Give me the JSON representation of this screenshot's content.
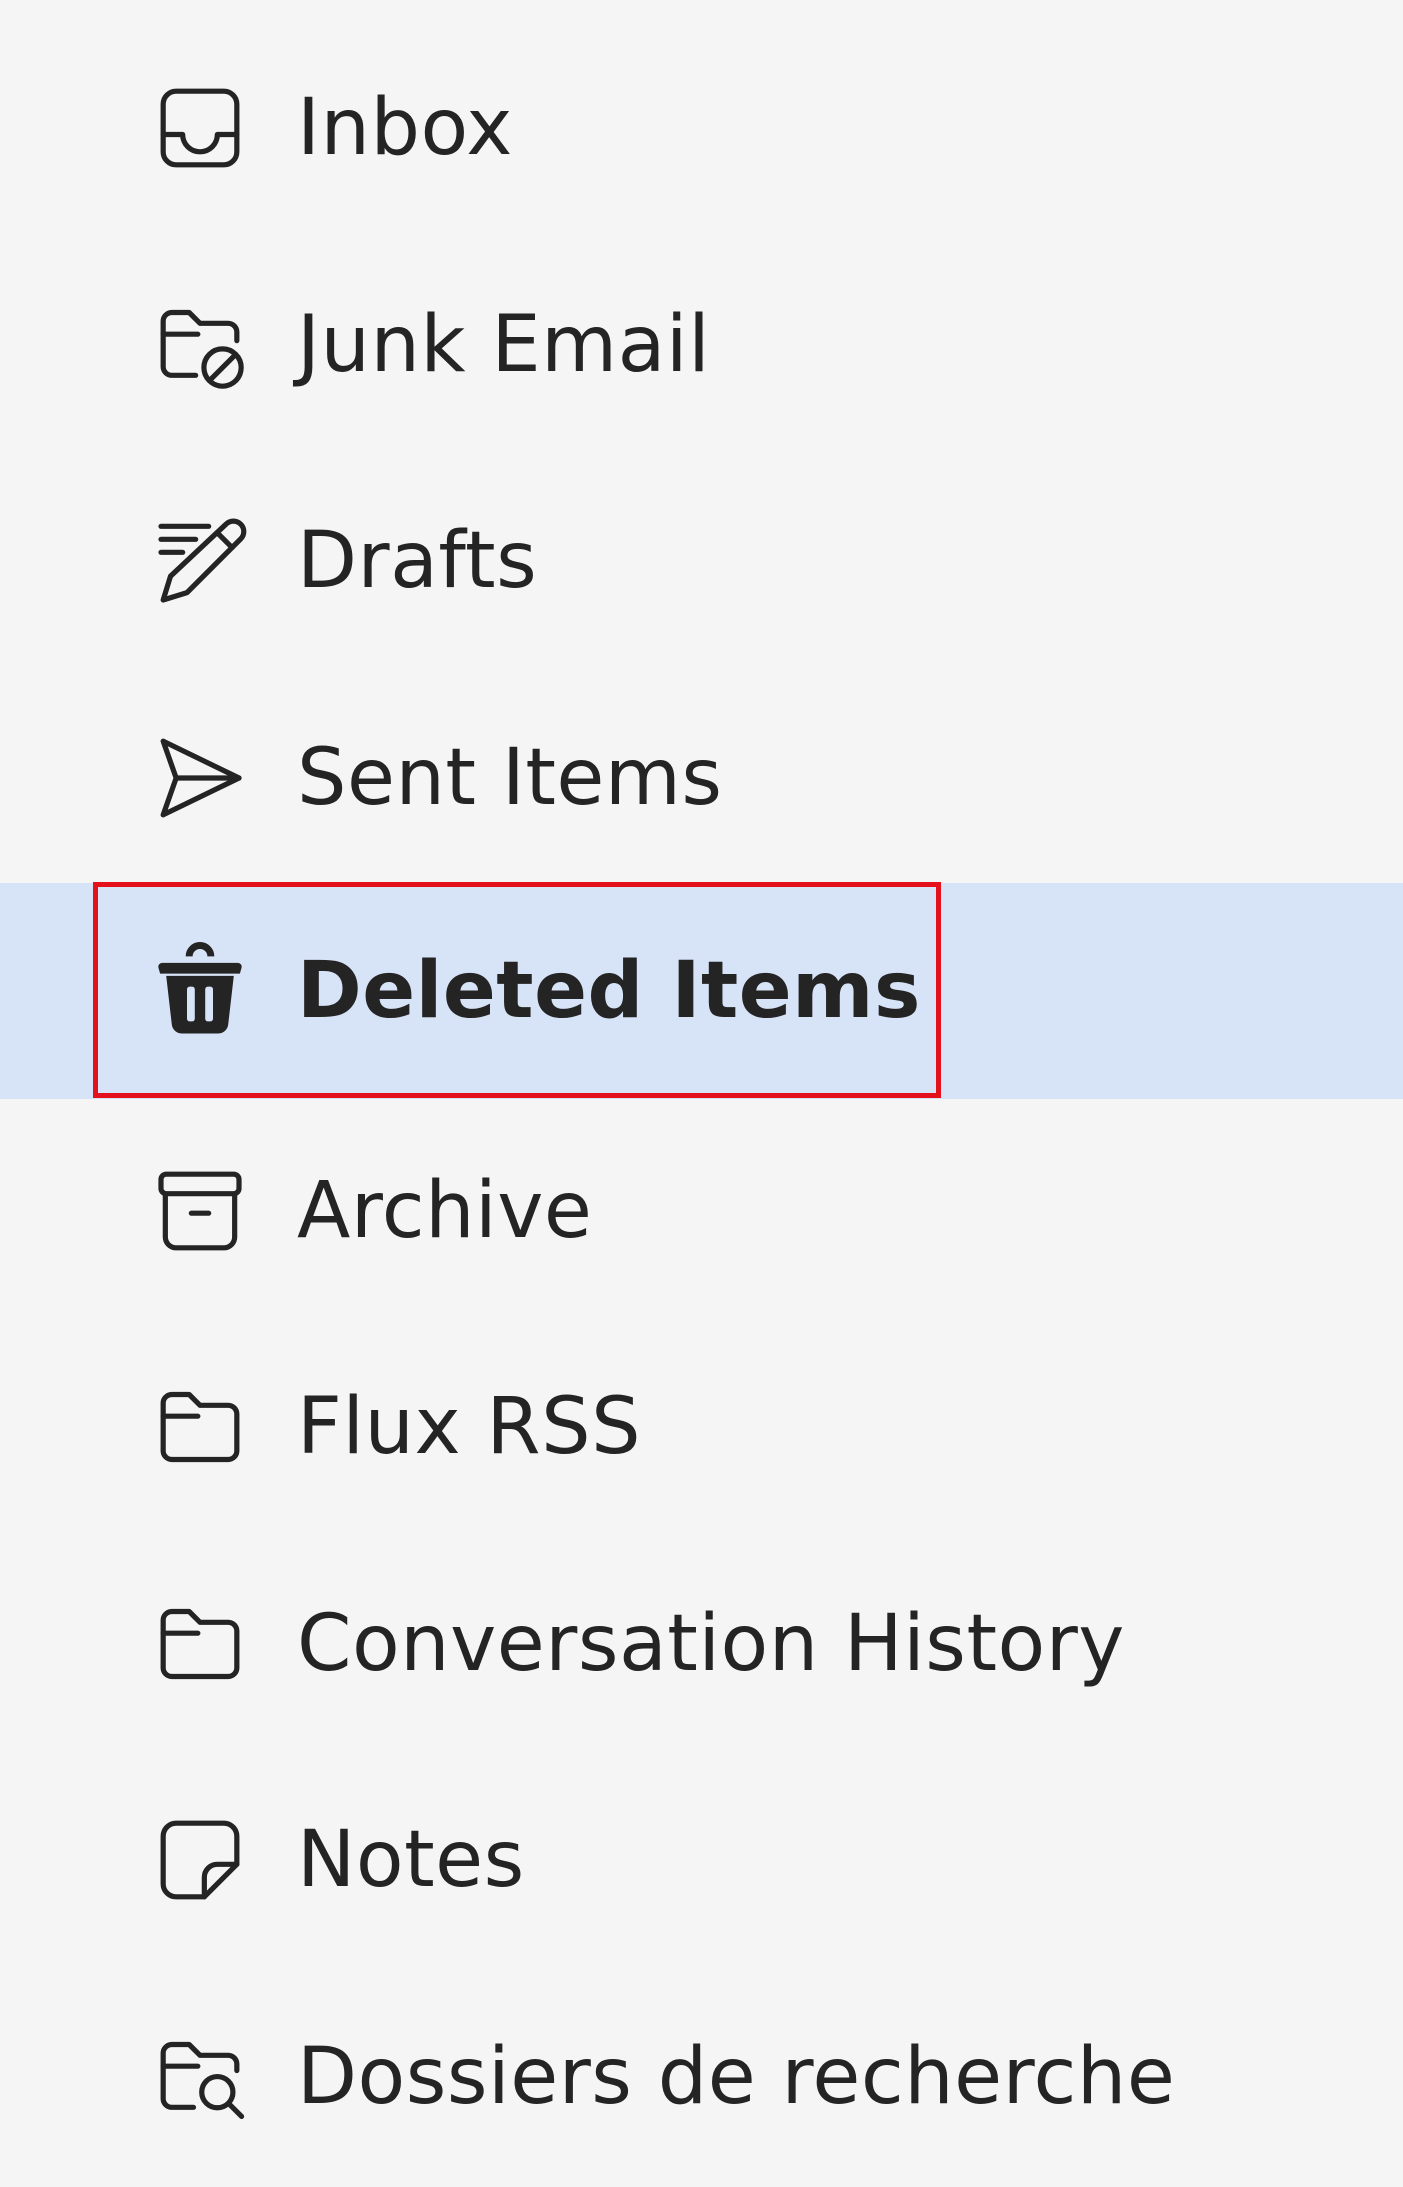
{
  "folder_pane": {
    "items": [
      {
        "label": "Inbox",
        "icon": "inbox-icon",
        "selected": false
      },
      {
        "label": "Junk Email",
        "icon": "junk-folder-icon",
        "selected": false
      },
      {
        "label": "Drafts",
        "icon": "drafts-pencil-icon",
        "selected": false
      },
      {
        "label": "Sent Items",
        "icon": "send-icon",
        "selected": false
      },
      {
        "label": "Deleted Items",
        "icon": "trash-icon",
        "selected": true
      },
      {
        "label": "Archive",
        "icon": "archive-icon",
        "selected": false
      },
      {
        "label": "Flux RSS",
        "icon": "folder-icon",
        "selected": false
      },
      {
        "label": "Conversation History",
        "icon": "folder-icon",
        "selected": false
      },
      {
        "label": "Notes",
        "icon": "note-icon",
        "selected": false
      },
      {
        "label": "Dossiers de recherche",
        "icon": "search-folder-icon",
        "selected": false
      }
    ]
  },
  "colors": {
    "background": "#f5f5f5",
    "selected_background": "#d7e3f7",
    "highlight_border": "#e4101b",
    "text": "#242424"
  }
}
